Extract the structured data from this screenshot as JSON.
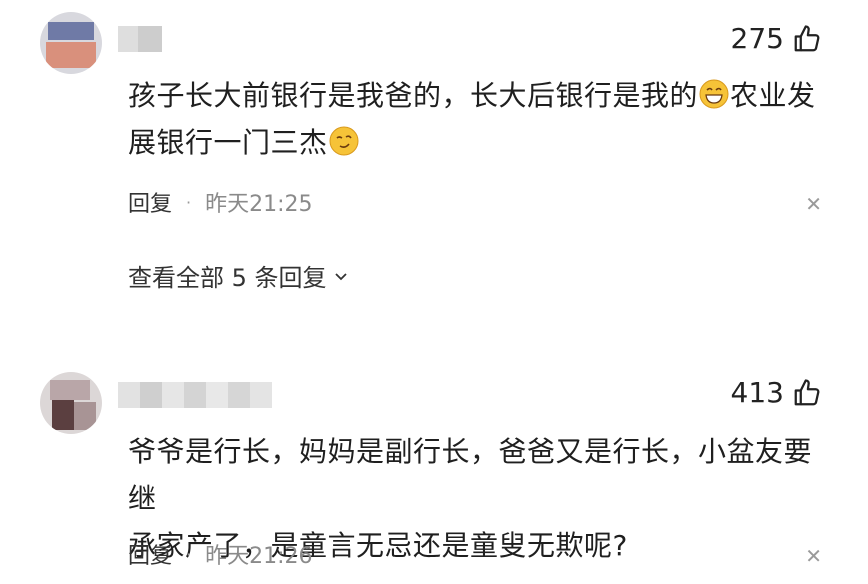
{
  "comments": [
    {
      "likes": "275",
      "text_line1": "孩子长大前银行是我爸的，长大后银行是我的",
      "text_line1_tail": "农业发",
      "text_line2": "展银行一门三杰",
      "reply_label": "回复",
      "time": "昨天21:25",
      "view_all": "查看全部 5 条回复",
      "emoji_1": "grinning-face-emoji",
      "emoji_2": "smirking-face-emoji"
    },
    {
      "likes": "413",
      "text_line1": "爷爷是行长，妈妈是副行长，爸爸又是行长，小盆友要继",
      "text_line2": "承家产了，是童言无忌还是童叟无欺呢?",
      "reply_label": "回复",
      "time": "昨天21:26"
    }
  ],
  "icons": {
    "like": "thumbs-up-icon",
    "close": "close-icon",
    "chevron": "chevron-down-icon"
  },
  "colors": {
    "meta_gray": "#8a8a8a",
    "text": "#1f1f1f"
  }
}
